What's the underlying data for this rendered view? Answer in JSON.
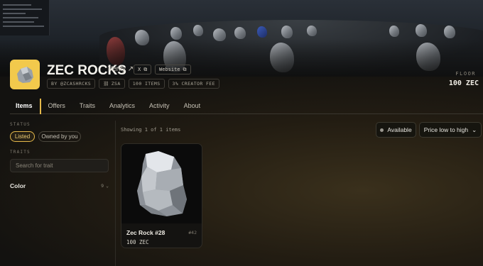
{
  "collection": {
    "title": "ZEC ROCKS",
    "verify_label": "Verify",
    "x_label": "X",
    "website_label": "Website",
    "meta": [
      "BY @ZCASHRCKS",
      "ZSA",
      "100 ITEMS",
      "3% CREATOR FEE"
    ],
    "floor_label": "FLOOR",
    "floor_value": "100 ZEC"
  },
  "tabs": [
    "Items",
    "Offers",
    "Traits",
    "Analytics",
    "Activity",
    "About"
  ],
  "active_tab": "Items",
  "sidebar": {
    "status_label": "STATUS",
    "status_options": [
      "Listed",
      "Owned by you"
    ],
    "selected_status": "Listed",
    "traits_label": "TRAITS",
    "trait_search_placeholder": "Search for trait",
    "trait_groups": [
      {
        "name": "Color",
        "count": "9"
      }
    ]
  },
  "results": {
    "showing_text": "Showing 1 of 1 items",
    "availability_label": "Available",
    "sort_label": "Price low to high"
  },
  "items": [
    {
      "name": "Zec Rock #28",
      "number": "#42",
      "price": "100 ZEC"
    }
  ],
  "colors": {
    "accent": "#e4b84a",
    "avatar_bg": "#f2c94c"
  },
  "icons": [
    "external-link-icon",
    "link-icon",
    "chevron-down-icon",
    "status-dot-icon"
  ]
}
